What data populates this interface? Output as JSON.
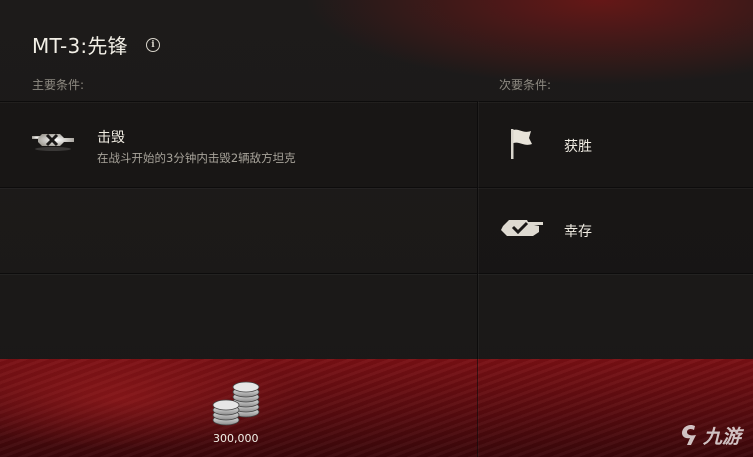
{
  "header": {
    "title": "MT-3:先锋",
    "info_icon": "info-icon"
  },
  "primary": {
    "section_label": "主要条件:",
    "objective": {
      "icon": "tank-destroyed-icon",
      "title": "击毁",
      "description": "在战斗开始的3分钟内击毁2辆敌方坦克"
    }
  },
  "secondary": {
    "section_label": "次要条件:",
    "items": [
      {
        "icon": "flag-icon",
        "label": "获胜"
      },
      {
        "icon": "tank-check-icon",
        "label": "幸存"
      }
    ]
  },
  "reward": {
    "icon": "silver-coins-icon",
    "value": "300,000"
  },
  "watermark": {
    "icon": "watermark-logo-icon",
    "text": "九游"
  },
  "colors": {
    "background": "#1a1817",
    "reward_red": "#6b0e12",
    "text": "#f0ece2",
    "muted_text": "#8e8a82"
  }
}
